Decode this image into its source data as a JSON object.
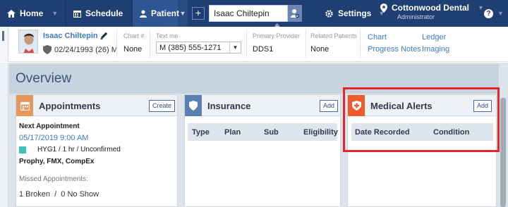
{
  "colors": {
    "nav": "#1f3f72",
    "link": "#3d7bc4",
    "highlight": "#e3262b",
    "appt_icon": "#e8975a",
    "ins_icon": "#5b7fb0",
    "med_icon": "#ee5a2b",
    "appt_swatch": "#3ec2b7"
  },
  "nav": {
    "home": "Home",
    "schedule": "Schedule",
    "patient": "Patient",
    "patient_search_value": "Isaac Chiltepin",
    "settings": "Settings",
    "office_name": "Cottonwood Dental",
    "office_role": "Administrator",
    "help": "?"
  },
  "patient": {
    "name": "Isaac Chiltepin",
    "dob_age": "02/24/1993 (26) M",
    "chart_label": "Chart #",
    "chart_value": "None",
    "textme_label": "Text me",
    "textme_value": "M (385) 555-1271",
    "provider_label": "Primary Provider",
    "provider_value": "DDS1",
    "related_label": "Related Patients",
    "related_value": "None",
    "links": {
      "chart": "Chart",
      "progress_notes": "Progress Notes",
      "ledger": "Ledger",
      "imaging": "Imaging"
    }
  },
  "overview": {
    "title": "Overview"
  },
  "appointments": {
    "title": "Appointments",
    "create_label": "Create",
    "next_label": "Next Appointment",
    "next_date": "05/17/2019 9:00 AM",
    "next_status": "HYG1 / 1 hr / Unconfirmed",
    "procedures": "Prophy, FMX, CompEx",
    "missed_label": "Missed Appointments:",
    "missed_counts": "1 Broken  /  0 No Show"
  },
  "insurance": {
    "title": "Insurance",
    "add_label": "Add",
    "columns": [
      "Type",
      "Plan",
      "Sub",
      "Eligibility"
    ]
  },
  "medical_alerts": {
    "title": "Medical Alerts",
    "add_label": "Add",
    "columns": [
      "Date Recorded",
      "Condition"
    ]
  }
}
